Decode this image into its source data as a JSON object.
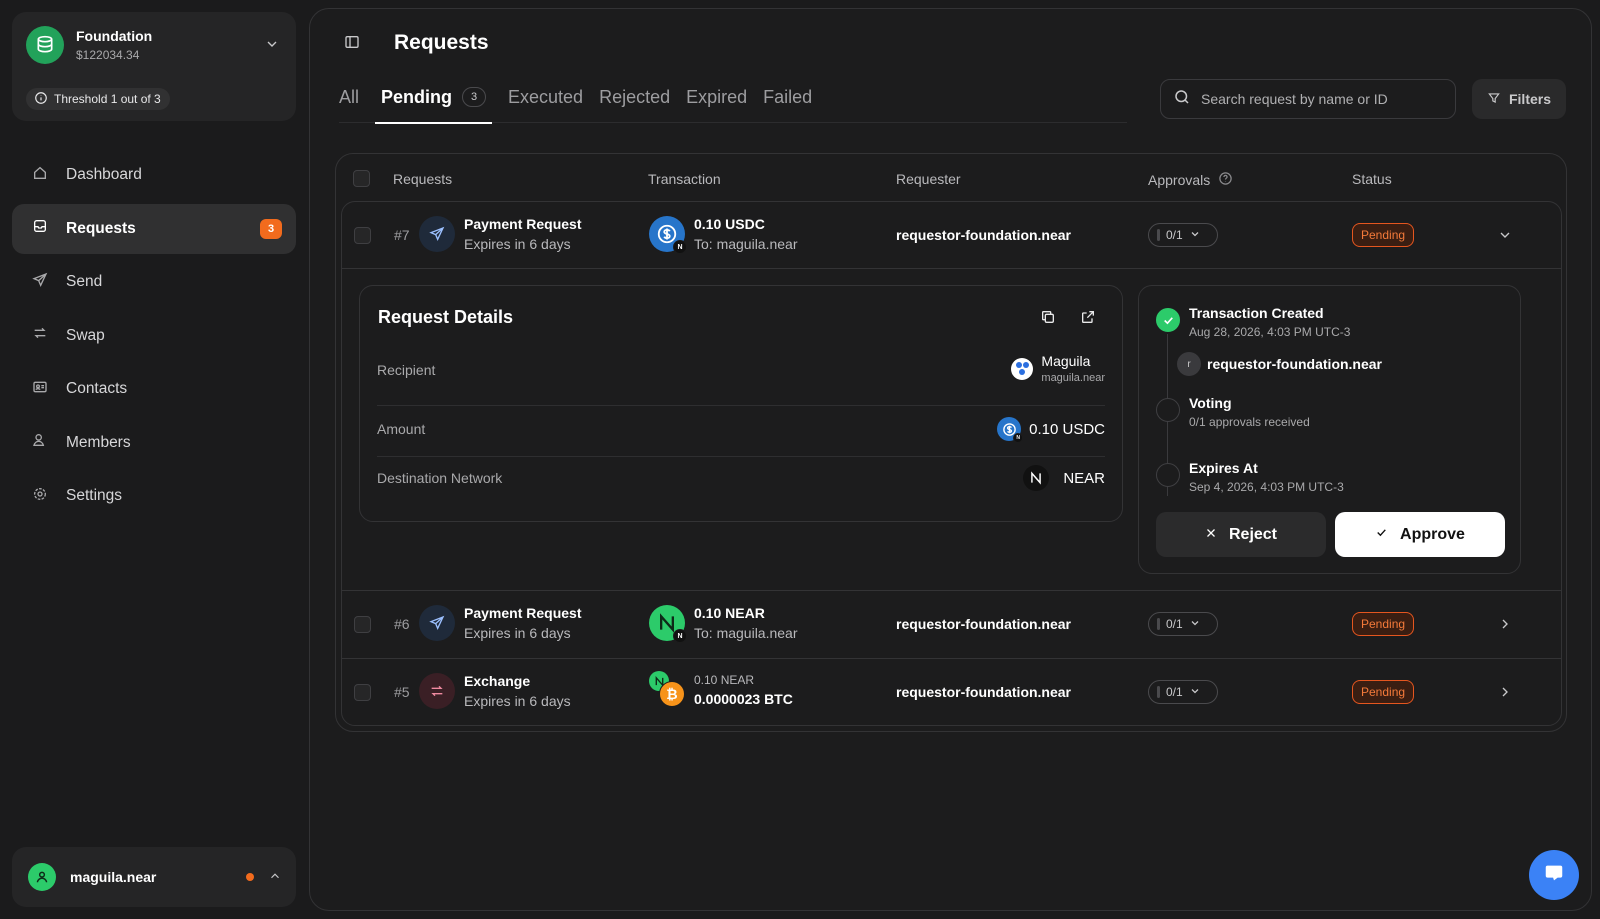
{
  "account": {
    "name": "Foundation",
    "balance": "$122034.34",
    "threshold": "Threshold 1 out of 3"
  },
  "nav": {
    "items": [
      {
        "label": "Dashboard",
        "icon": "home-icon"
      },
      {
        "label": "Requests",
        "icon": "inbox-icon",
        "badge": "3",
        "active": true
      },
      {
        "label": "Send",
        "icon": "send-icon"
      },
      {
        "label": "Swap",
        "icon": "swap-icon"
      },
      {
        "label": "Contacts",
        "icon": "contact-card-icon"
      },
      {
        "label": "Members",
        "icon": "members-icon"
      },
      {
        "label": "Settings",
        "icon": "gear-icon"
      }
    ]
  },
  "user": {
    "name": "maguila.near"
  },
  "header": {
    "title": "Requests"
  },
  "tabs": [
    {
      "label": "All"
    },
    {
      "label": "Pending",
      "count": "3",
      "active": true
    },
    {
      "label": "Executed"
    },
    {
      "label": "Rejected"
    },
    {
      "label": "Expired"
    },
    {
      "label": "Failed"
    }
  ],
  "search": {
    "placeholder": "Search request by name or ID"
  },
  "filters_label": "Filters",
  "table": {
    "columns": [
      "Requests",
      "Transaction",
      "Requester",
      "Approvals",
      "Status"
    ],
    "rows": [
      {
        "id": "#7",
        "type": "Payment Request",
        "expires": "Expires in 6 days",
        "amount": "0.10 USDC",
        "to": "To: maguila.near",
        "requester": "requestor-foundation.near",
        "approvals": "0/1",
        "status": "Pending"
      },
      {
        "id": "#6",
        "type": "Payment Request",
        "expires": "Expires in 6 days",
        "amount": "0.10 NEAR",
        "to": "To: maguila.near",
        "requester": "requestor-foundation.near",
        "approvals": "0/1",
        "status": "Pending"
      },
      {
        "id": "#5",
        "type": "Exchange",
        "expires": "Expires in 6 days",
        "from_amount": "0.10 NEAR",
        "to_amount": "0.0000023 BTC",
        "requester": "requestor-foundation.near",
        "approvals": "0/1",
        "status": "Pending"
      }
    ]
  },
  "details": {
    "title": "Request Details",
    "recipient_label": "Recipient",
    "recipient_name": "Maguila",
    "recipient_account": "maguila.near",
    "amount_label": "Amount",
    "amount_value": "0.10 USDC",
    "network_label": "Destination Network",
    "network_value": "NEAR"
  },
  "timeline": {
    "created_title": "Transaction Created",
    "created_date": "Aug 28, 2026, 4:03 PM UTC-3",
    "creator_initial": "r",
    "creator": "requestor-foundation.near",
    "voting_title": "Voting",
    "voting_sub": "0/1 approvals received",
    "expires_title": "Expires At",
    "expires_date": "Sep 4, 2026, 4:03 PM UTC-3",
    "reject_label": "Reject",
    "approve_label": "Approve"
  },
  "colors": {
    "accent_green": "#2ccb6a",
    "pending_orange": "#f26b1d",
    "usdc_blue": "#2775ca",
    "btc_orange": "#f7931a",
    "chat_blue": "#3b82f6"
  }
}
